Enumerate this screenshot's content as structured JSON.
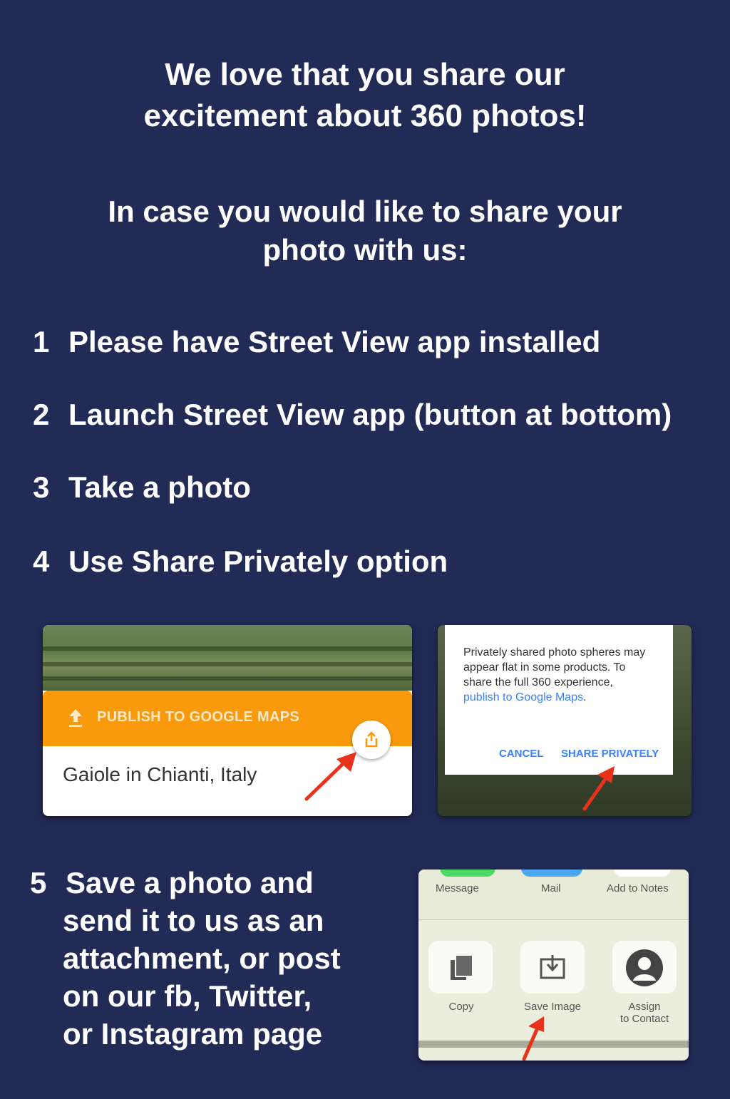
{
  "heading": {
    "line1": "We love that you share our",
    "line2": "excitement about 360 photos!",
    "sub1": "In case you would like to share your",
    "sub2": "photo with us:"
  },
  "steps": [
    {
      "num": "1",
      "text": "Please have Street View app installed"
    },
    {
      "num": "2",
      "text": "Launch Street View app (button at bottom)"
    },
    {
      "num": "3",
      "text": "Take a photo"
    },
    {
      "num": "4",
      "text": "Use Share Privately option"
    },
    {
      "num": "5",
      "lines": [
        "Save a photo and",
        "send it to us as an",
        "attachment, or post",
        "on our fb, Twitter,",
        "or Instagram page"
      ]
    }
  ],
  "shot1": {
    "publish_label": "PUBLISH TO GOOGLE MAPS",
    "place": "Gaiole in Chianti, Italy",
    "icons": [
      "upload-icon",
      "share-icon"
    ],
    "accent": "#f89a0c"
  },
  "shot2": {
    "text_before": "Privately shared photo spheres may appear flat in some products. To share the full 360 experience, ",
    "link": "publish to Google Maps",
    "text_after": ".",
    "cancel": "CANCEL",
    "share_privately": "SHARE PRIVATELY",
    "link_color": "#3b82f6"
  },
  "shot3": {
    "top_items": [
      "Message",
      "Mail",
      "Add to Notes"
    ],
    "actions": [
      "Copy",
      "Save Image"
    ],
    "assign_lines": [
      "Assign",
      "to Contact"
    ],
    "icons": [
      "copy-icon",
      "save-image-icon",
      "contact-icon"
    ]
  },
  "colors": {
    "background": "#222a56",
    "arrow": "#e8321c"
  }
}
